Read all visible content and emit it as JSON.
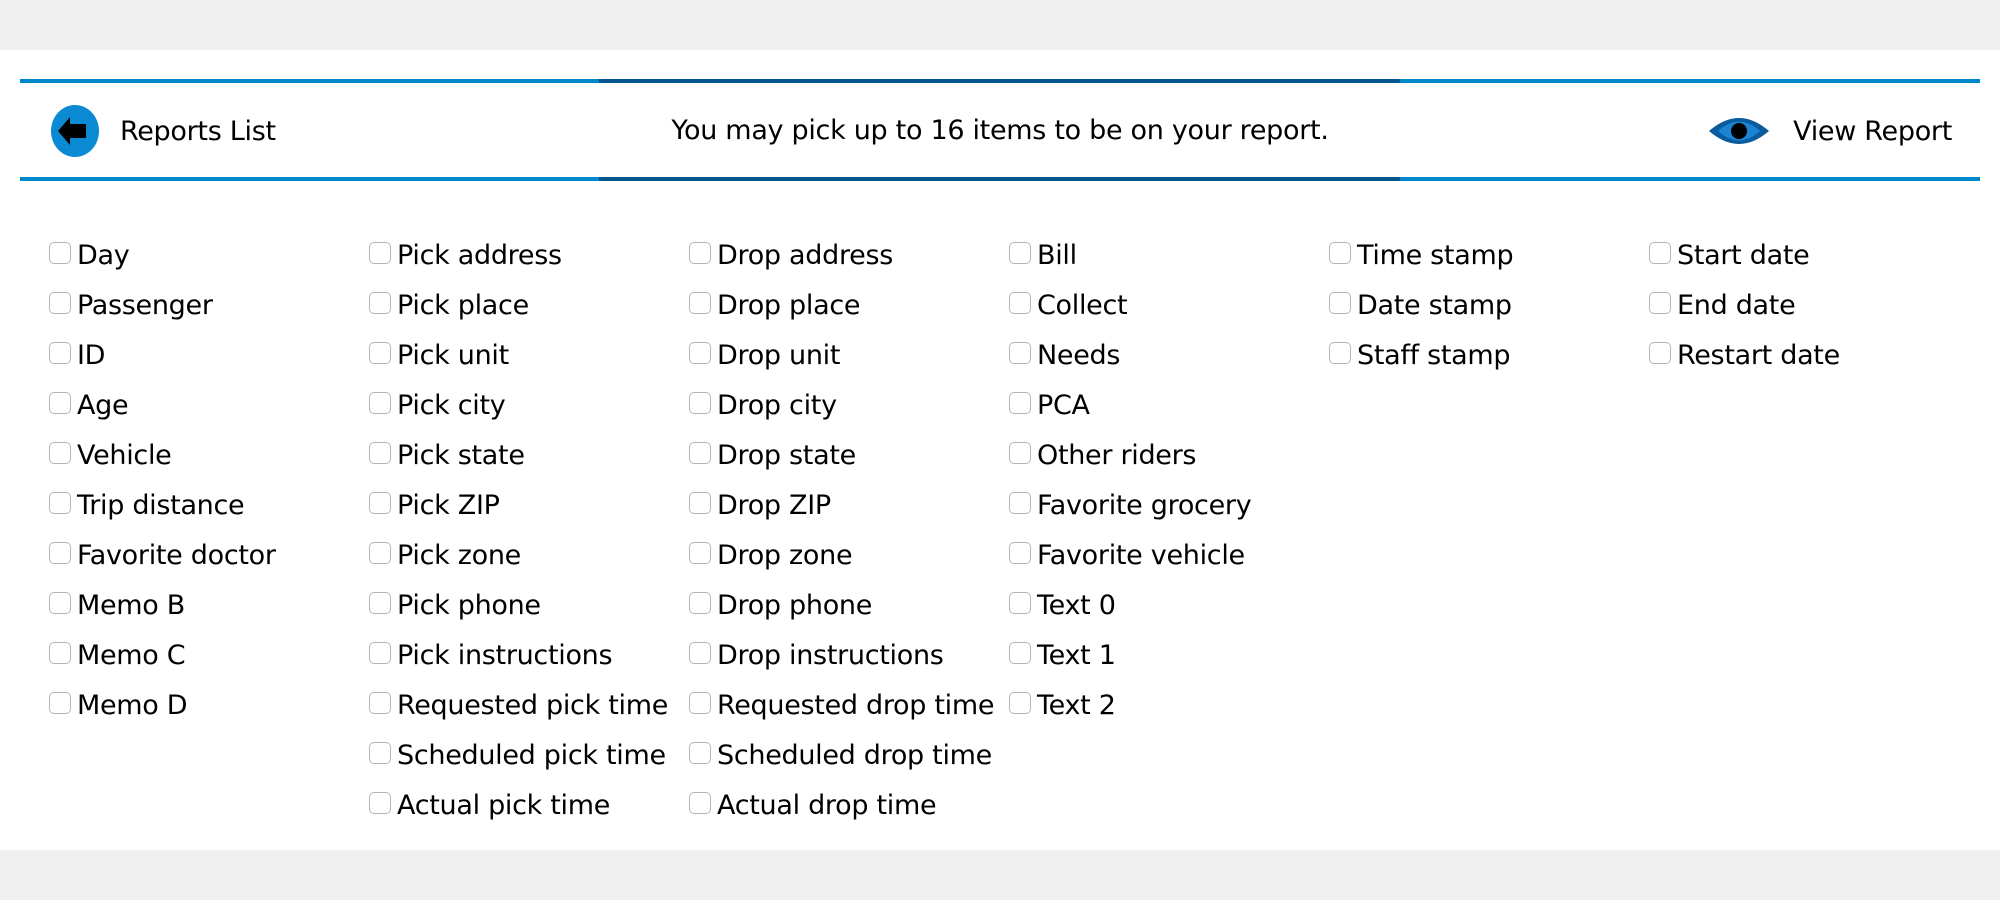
{
  "header": {
    "back_label": "Reports List",
    "back_icon": "arrow-left-circle-icon",
    "info_text": "You may pick up to 16 items to be on your report.",
    "view_label": "View Report",
    "view_icon": "eye-icon"
  },
  "colors": {
    "page_background": "#f0f0f0",
    "panel_background": "#ffffff",
    "accent_blue": "#0088cc",
    "accent_dark_blue": "#00558f",
    "eye_outer": "#0b5c9e",
    "eye_inner": "#1a84d2"
  },
  "columns": [
    {
      "items": [
        {
          "label": "Day",
          "checked": false
        },
        {
          "label": "Passenger",
          "checked": false
        },
        {
          "label": "ID",
          "checked": false
        },
        {
          "label": "Age",
          "checked": false
        },
        {
          "label": "Vehicle",
          "checked": false
        },
        {
          "label": "Trip distance",
          "checked": false
        },
        {
          "label": "Favorite doctor",
          "checked": false
        },
        {
          "label": "Memo B",
          "checked": false
        },
        {
          "label": "Memo C",
          "checked": false
        },
        {
          "label": "Memo D",
          "checked": false
        }
      ]
    },
    {
      "items": [
        {
          "label": "Pick address",
          "checked": false
        },
        {
          "label": "Pick place",
          "checked": false
        },
        {
          "label": "Pick unit",
          "checked": false
        },
        {
          "label": "Pick city",
          "checked": false
        },
        {
          "label": "Pick state",
          "checked": false
        },
        {
          "label": "Pick ZIP",
          "checked": false
        },
        {
          "label": "Pick zone",
          "checked": false
        },
        {
          "label": "Pick phone",
          "checked": false
        },
        {
          "label": "Pick instructions",
          "checked": false
        },
        {
          "label": "Requested pick time",
          "checked": false
        },
        {
          "label": "Scheduled pick time",
          "checked": false
        },
        {
          "label": "Actual pick time",
          "checked": false
        }
      ]
    },
    {
      "items": [
        {
          "label": "Drop address",
          "checked": false
        },
        {
          "label": "Drop place",
          "checked": false
        },
        {
          "label": "Drop unit",
          "checked": false
        },
        {
          "label": "Drop city",
          "checked": false
        },
        {
          "label": "Drop state",
          "checked": false
        },
        {
          "label": "Drop ZIP",
          "checked": false
        },
        {
          "label": "Drop zone",
          "checked": false
        },
        {
          "label": "Drop phone",
          "checked": false
        },
        {
          "label": "Drop instructions",
          "checked": false
        },
        {
          "label": "Requested drop time",
          "checked": false
        },
        {
          "label": "Scheduled drop time",
          "checked": false
        },
        {
          "label": "Actual drop time",
          "checked": false
        }
      ]
    },
    {
      "items": [
        {
          "label": "Bill",
          "checked": false
        },
        {
          "label": "Collect",
          "checked": false
        },
        {
          "label": "Needs",
          "checked": false
        },
        {
          "label": "PCA",
          "checked": false
        },
        {
          "label": "Other riders",
          "checked": false
        },
        {
          "label": "Favorite grocery",
          "checked": false
        },
        {
          "label": "Favorite vehicle",
          "checked": false
        },
        {
          "label": "Text 0",
          "checked": false
        },
        {
          "label": "Text 1",
          "checked": false
        },
        {
          "label": "Text 2",
          "checked": false
        }
      ]
    },
    {
      "items": [
        {
          "label": "Time stamp",
          "checked": false
        },
        {
          "label": "Date stamp",
          "checked": false
        },
        {
          "label": "Staff stamp",
          "checked": false
        }
      ]
    },
    {
      "items": [
        {
          "label": "Start date",
          "checked": false
        },
        {
          "label": "End date",
          "checked": false
        },
        {
          "label": "Restart date",
          "checked": false
        }
      ]
    }
  ]
}
